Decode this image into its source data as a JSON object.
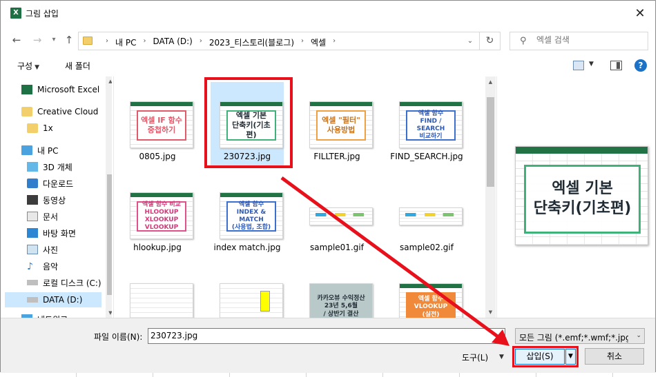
{
  "window": {
    "title": "그림 삽입",
    "app_icon": "excel-icon",
    "close_glyph": "✕"
  },
  "address": {
    "crumbs": [
      "내 PC",
      "DATA (D:)",
      "2023_티스토리(블로그)",
      "엑셀"
    ],
    "separator": "›"
  },
  "search": {
    "placeholder": "엑셀 검색"
  },
  "toolbar": {
    "organize_label": "구성",
    "new_folder_label": "새 폴더",
    "help_label": "?"
  },
  "nav": {
    "items": [
      {
        "label": "Microsoft Excel",
        "icon": "excel-icon"
      },
      {
        "label": "Creative Cloud Fil",
        "icon": "creative-cloud-folder-icon"
      },
      {
        "label": "1x",
        "icon": "folder-sync-icon"
      },
      {
        "label": "내 PC",
        "icon": "computer-icon"
      },
      {
        "label": "3D 개체",
        "icon": "cube-icon"
      },
      {
        "label": "다운로드",
        "icon": "download-icon"
      },
      {
        "label": "동영상",
        "icon": "film-icon"
      },
      {
        "label": "문서",
        "icon": "document-icon"
      },
      {
        "label": "바탕 화면",
        "icon": "desktop-icon"
      },
      {
        "label": "사진",
        "icon": "picture-icon"
      },
      {
        "label": "음악",
        "icon": "music-icon"
      },
      {
        "label": "로컬 디스크 (C:)",
        "icon": "drive-icon"
      },
      {
        "label": "DATA (D:)",
        "icon": "drive-icon"
      },
      {
        "label": "네트워크",
        "icon": "network-icon"
      }
    ],
    "selected_index": 12
  },
  "files": [
    {
      "name": "0805.jpg",
      "thumb": [
        "엑셀 IF 함수",
        "중첩하기"
      ],
      "border": "#e05a6a",
      "color": "#e05a6a"
    },
    {
      "name": "230723.jpg",
      "thumb": [
        "엑셀 기본",
        "단축키(기초편)"
      ],
      "border": "#3fb27a",
      "color": "#1f2a33"
    },
    {
      "name": "FILLTER.jpg",
      "thumb": [
        "엑셀 \"필터\"",
        "사용방법"
      ],
      "border": "#f0a040",
      "color": "#c97520"
    },
    {
      "name": "FIND_SEARCH.jpg",
      "thumb": [
        "엑셀 함수",
        "FIND / SEARCH",
        "비교하기"
      ],
      "border": "#3a6fd0",
      "color": "#2c58b8"
    },
    {
      "name": "hlookup.jpg",
      "thumb": [
        "엑셀 함수 비교",
        "HLOOKUP",
        "XLOOKUP",
        "VLOOKUP"
      ],
      "border": "#e0508a",
      "color": "#d23a7a"
    },
    {
      "name": "index match.jpg",
      "thumb": [
        "엑셀 함수",
        "INDEX & MATCH",
        "(사용법, 조합)"
      ],
      "border": "#3a6fd0",
      "color": "#2c58b8"
    },
    {
      "name": "sample01.gif",
      "thumb": [],
      "border": "",
      "color": ""
    },
    {
      "name": "sample02.gif",
      "thumb": [],
      "border": "",
      "color": ""
    },
    {
      "name": "",
      "thumb": [],
      "border": "",
      "color": ""
    },
    {
      "name": "",
      "thumb": [],
      "border": "",
      "color": ""
    },
    {
      "name": "",
      "thumb": [
        "카카오뷰 수익정산",
        "23년 5,6월",
        "/ 상반기 결산"
      ],
      "border": "",
      "color": "#1f2a33"
    },
    {
      "name": "",
      "thumb": [
        "엑셀 함수",
        "VLOOKUP",
        "(실전)"
      ],
      "border": "#f0a040",
      "color": "#ffffff"
    }
  ],
  "preview": {
    "line1": "엑셀 기본",
    "line2": "단축키(기초편)"
  },
  "bottom": {
    "filename_label": "파일 이름(N):",
    "filename_value": "230723.jpg",
    "filetype_value": "모든 그림 (*.emf;*.wmf;*.jpg;*.",
    "tools_label": "도구(L)",
    "insert_label": "삽입(S)",
    "cancel_label": "취소"
  },
  "colors": {
    "annotation_red": "#e8101b",
    "selection_blue": "#cce8ff",
    "excel_green": "#217346"
  }
}
